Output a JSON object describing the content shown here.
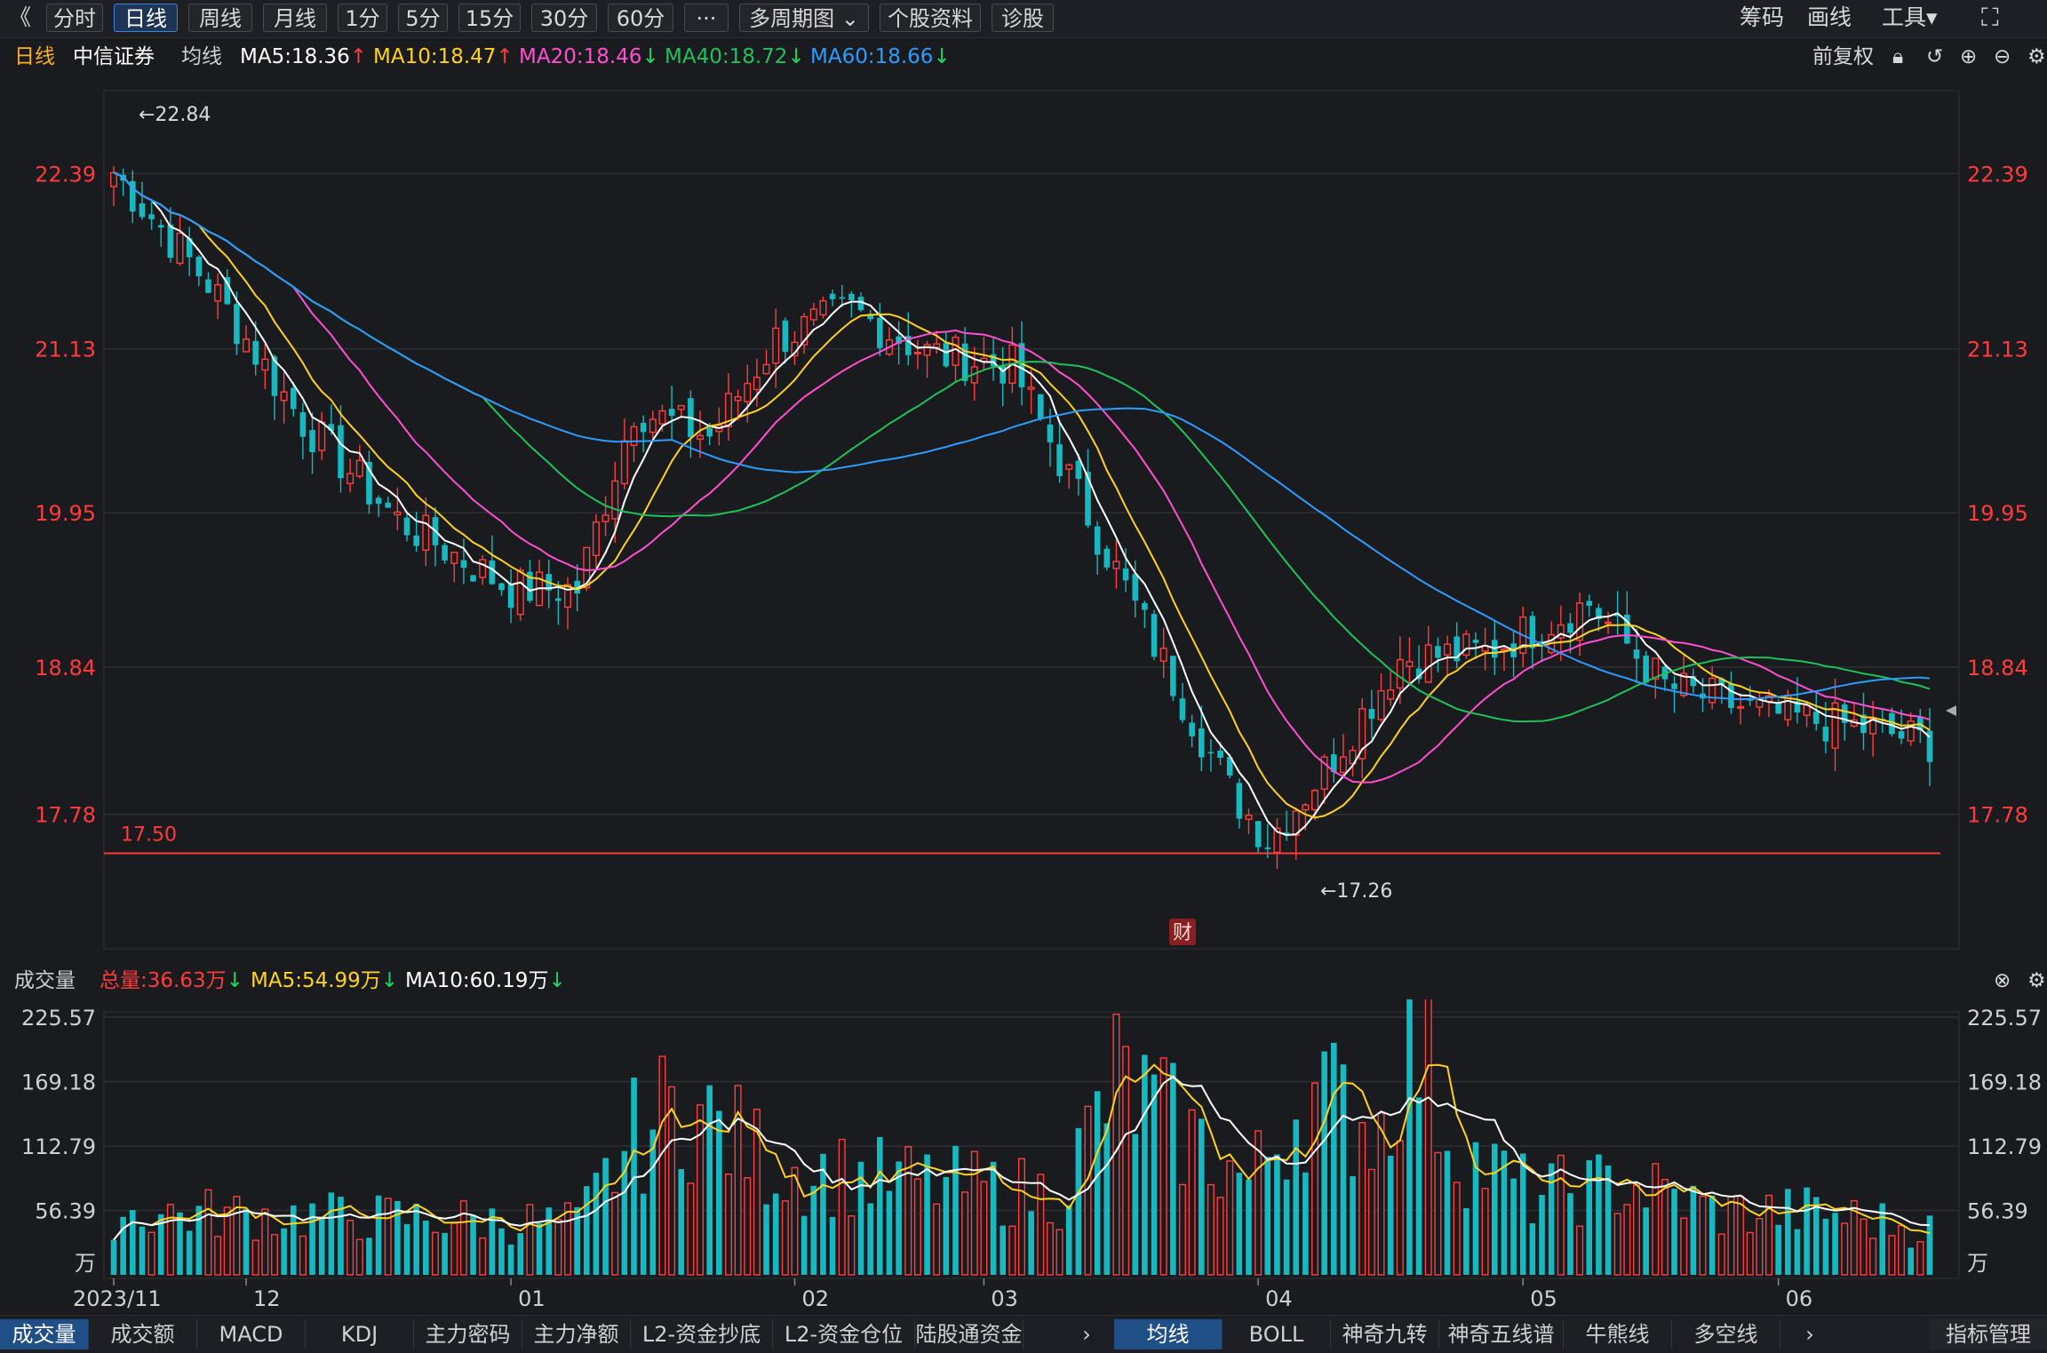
{
  "toolbar": {
    "back_icon": "double-chevron-left-icon",
    "periods": [
      "分时",
      "日线",
      "周线",
      "月线",
      "1分",
      "5分",
      "15分",
      "30分",
      "60分",
      "···",
      "多周期图 ⌄",
      "个股资料",
      "诊股"
    ],
    "active_period": "日线",
    "right_items": [
      "筹码",
      "画线",
      "工具▾"
    ],
    "fullscreen_icon": "fullscreen-icon"
  },
  "legend": {
    "period": "日线",
    "stock_name": "中信证券",
    "ma_label": "均线",
    "ma5": "MA5:18.36",
    "ma10": "MA10:18.47",
    "ma20": "MA20:18.46",
    "ma40": "MA40:18.72",
    "ma60": "MA60:18.66",
    "restore": "前复权",
    "colors": {
      "ma5": "#ffffff",
      "ma10": "#ffd21e",
      "ma20": "#ff4fd0",
      "ma40": "#1fc25a",
      "ma60": "#2d9cff"
    }
  },
  "volume_legend": {
    "title": "成交量",
    "total": "总量:36.63万",
    "ma5": "MA5:54.99万",
    "ma10": "MA10:60.19万"
  },
  "chart_data": [
    {
      "type": "candlestick",
      "ylim": [
        16.8,
        23.0
      ],
      "yticks": [
        "22.39",
        "21.13",
        "19.95",
        "18.84",
        "17.78"
      ],
      "high_annotation": "←22.84",
      "low_annotation": "←17.26",
      "hline": {
        "value": 17.5,
        "label": "17.50"
      },
      "marker": "财",
      "xticks": [
        "2023/11",
        "12",
        "01",
        "02",
        "03",
        "04",
        "05",
        "06"
      ],
      "key_points": [
        {
          "x": 0,
          "close": 22.4
        },
        {
          "x": 10,
          "close": 21.6
        },
        {
          "x": 20,
          "close": 20.6
        },
        {
          "x": 30,
          "close": 19.9
        },
        {
          "x": 42,
          "close": 19.4
        },
        {
          "x": 49,
          "close": 19.4
        },
        {
          "x": 55,
          "close": 20.7
        },
        {
          "x": 63,
          "close": 20.5
        },
        {
          "x": 70,
          "close": 21.2
        },
        {
          "x": 78,
          "close": 21.4
        },
        {
          "x": 86,
          "close": 21.1
        },
        {
          "x": 95,
          "close": 21.0
        },
        {
          "x": 110,
          "close": 19.0
        },
        {
          "x": 118,
          "close": 17.95
        },
        {
          "x": 122,
          "close": 17.6
        },
        {
          "x": 128,
          "close": 18.1
        },
        {
          "x": 136,
          "close": 18.9
        },
        {
          "x": 145,
          "close": 18.95
        },
        {
          "x": 156,
          "close": 19.3
        },
        {
          "x": 164,
          "close": 18.7
        },
        {
          "x": 175,
          "close": 18.5
        },
        {
          "x": 185,
          "close": 18.4
        },
        {
          "x": 192,
          "close": 18.3
        }
      ]
    },
    {
      "type": "bar",
      "ylim": [
        0,
        225.57
      ],
      "yticks": [
        "225.57",
        "169.18",
        "112.79",
        "56.39"
      ],
      "unit": "万",
      "key_points": [
        {
          "x": 0,
          "v": 55
        },
        {
          "x": 30,
          "v": 50
        },
        {
          "x": 49,
          "v": 45
        },
        {
          "x": 55,
          "v": 120
        },
        {
          "x": 60,
          "v": 150
        },
        {
          "x": 70,
          "v": 95
        },
        {
          "x": 80,
          "v": 85
        },
        {
          "x": 100,
          "v": 70
        },
        {
          "x": 106,
          "v": 170
        },
        {
          "x": 120,
          "v": 80
        },
        {
          "x": 126,
          "v": 160
        },
        {
          "x": 134,
          "v": 130
        },
        {
          "x": 137,
          "v": 225
        },
        {
          "x": 142,
          "v": 110
        },
        {
          "x": 150,
          "v": 70
        },
        {
          "x": 160,
          "v": 80
        },
        {
          "x": 170,
          "v": 55
        },
        {
          "x": 180,
          "v": 55
        },
        {
          "x": 192,
          "v": 40
        }
      ]
    }
  ],
  "bottom_tabs_left": [
    "成交量",
    "成交额",
    "MACD",
    "KDJ",
    "主力密码",
    "主力净额",
    "L2-资金抄底",
    "L2-资金仓位",
    "陆股通资金"
  ],
  "bottom_tabs_right": [
    "均线",
    "BOLL",
    "神奇九转",
    "神奇五线谱",
    "牛熊线",
    "多空线"
  ],
  "bottom_right": "指标管理",
  "active_bottom_left": "成交量",
  "active_bottom_right": "均线"
}
